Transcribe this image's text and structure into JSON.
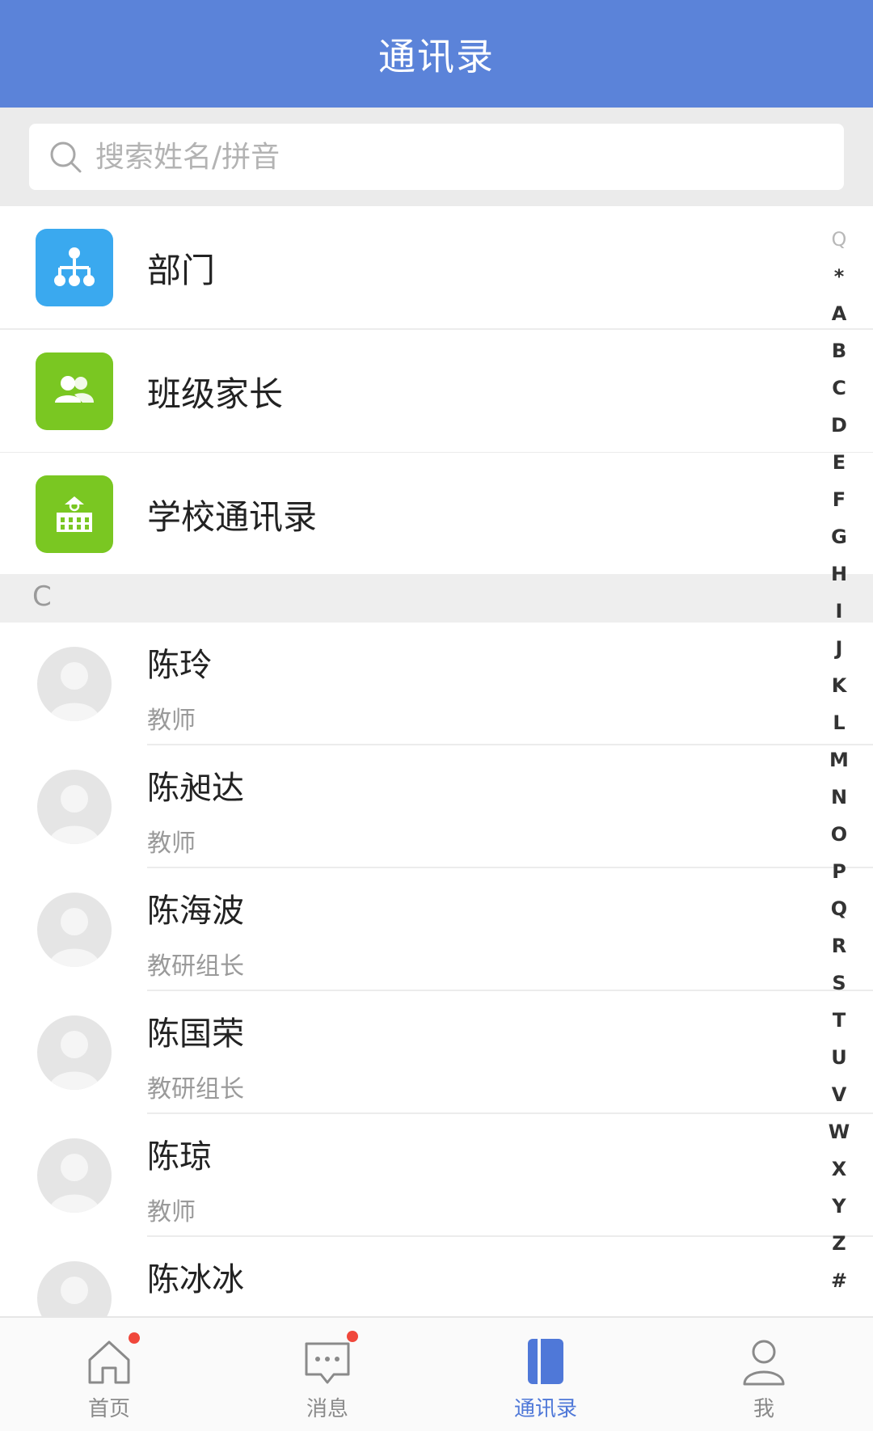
{
  "header": {
    "title": "通讯录"
  },
  "search": {
    "placeholder": "搜索姓名/拼音"
  },
  "menu": [
    {
      "label": "部门",
      "icon": "org-chart-icon",
      "color": "#3aa9ef"
    },
    {
      "label": "班级家长",
      "icon": "people-icon",
      "color": "#7ac722"
    },
    {
      "label": "学校通讯录",
      "icon": "school-icon",
      "color": "#7ac722"
    }
  ],
  "section": {
    "letter": "C"
  },
  "contacts": [
    {
      "name": "陈玲",
      "role": "教师"
    },
    {
      "name": "陈昶达",
      "role": "教师"
    },
    {
      "name": "陈海波",
      "role": "教研组长"
    },
    {
      "name": "陈国荣",
      "role": "教研组长"
    },
    {
      "name": "陈琼",
      "role": "教师"
    },
    {
      "name": "陈冰冰",
      "role": ""
    }
  ],
  "index": [
    "Q",
    "*",
    "A",
    "B",
    "C",
    "D",
    "E",
    "F",
    "G",
    "H",
    "I",
    "J",
    "K",
    "L",
    "M",
    "N",
    "O",
    "P",
    "Q",
    "R",
    "S",
    "T",
    "U",
    "V",
    "W",
    "X",
    "Y",
    "Z",
    "#"
  ],
  "tabs": [
    {
      "label": "首页",
      "icon": "home-icon",
      "badge": true,
      "active": false
    },
    {
      "label": "消息",
      "icon": "message-icon",
      "badge": true,
      "active": false
    },
    {
      "label": "通讯录",
      "icon": "contacts-icon",
      "badge": false,
      "active": true
    },
    {
      "label": "我",
      "icon": "profile-icon",
      "badge": false,
      "active": false
    }
  ],
  "colors": {
    "header": "#5b83d9",
    "active_tab": "#4f78d8",
    "badge": "#f0473b"
  }
}
